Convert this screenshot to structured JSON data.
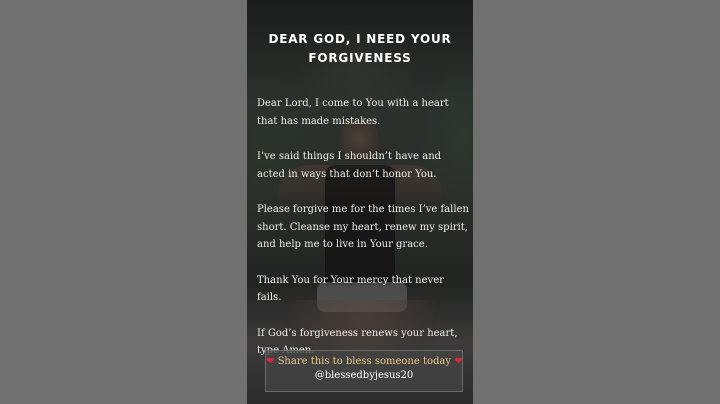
{
  "post": {
    "title_line1": "DEAR GOD, I NEED YOUR",
    "title_line2": "FORGIVENESS",
    "paragraphs": [
      "Dear Lord, I come to You with a heart that has made mistakes.",
      "I’ve said things I shouldn’t have and acted in ways that don’t honor You.",
      "Please forgive me for the times I’ve fallen short. Cleanse my heart, renew my spirit, and help me to live in Your grace.",
      "Thank You for Your mercy that never fails.",
      "If God’s forgiveness renews your heart, type Amen."
    ],
    "share_text": "Share this to bless someone today",
    "heart_glyph": "❤",
    "handle": "@blessedbyjesus20"
  },
  "colors": {
    "side_bars": "#717171",
    "title": "#ffffff",
    "body_text": "#f2efe8",
    "share_text": "#e9c98a",
    "heart": "#e0243b"
  },
  "icons": {
    "heart_left": "heart-icon",
    "heart_right": "heart-icon"
  }
}
